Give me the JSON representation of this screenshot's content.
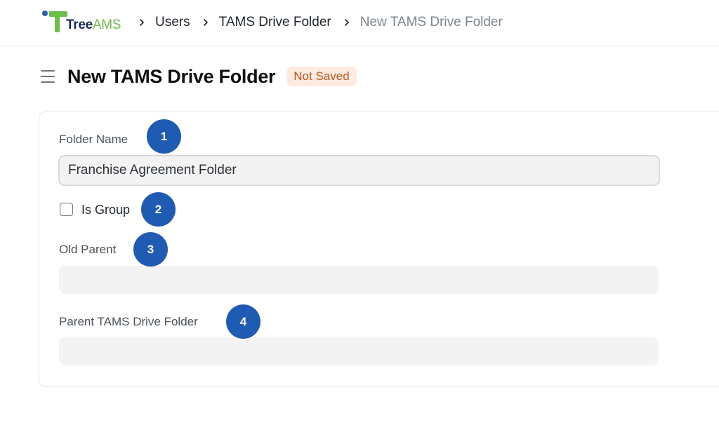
{
  "logo": {
    "brand_part1": "Tree",
    "brand_part2": "AMS"
  },
  "breadcrumb": [
    {
      "label": "Users"
    },
    {
      "label": "TAMS Drive Folder"
    },
    {
      "label": "New TAMS Drive Folder"
    }
  ],
  "header": {
    "title": "New TAMS Drive Folder",
    "status_badge": "Not Saved"
  },
  "form": {
    "folder_name": {
      "label": "Folder Name",
      "value": "Franchise Agreement Folder"
    },
    "is_group": {
      "label": "Is Group",
      "checked": false
    },
    "old_parent": {
      "label": "Old Parent",
      "value": ""
    },
    "parent_folder": {
      "label": "Parent TAMS Drive Folder",
      "value": ""
    }
  },
  "markers": [
    "1",
    "2",
    "3",
    "4"
  ],
  "colors": {
    "marker": "#1f5bb3",
    "badge_bg": "#fdebe0",
    "badge_text": "#c3551b",
    "logo_green": "#6cc04a",
    "logo_navy": "#1a2a5a"
  }
}
